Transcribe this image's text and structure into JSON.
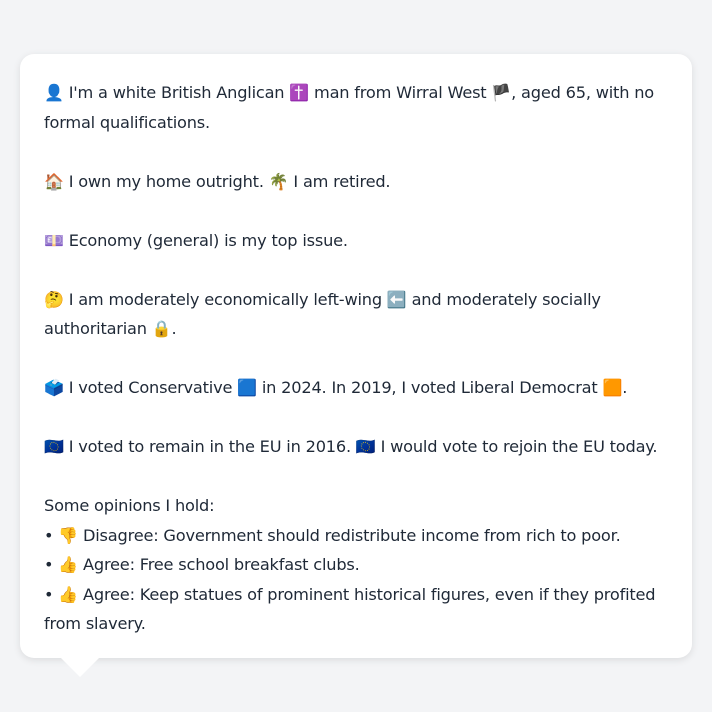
{
  "profile": {
    "identity": {
      "icon": "👤",
      "text": "I'm a white British Anglican",
      "religion_icon": "✝️",
      "text2": "man from Wirral West",
      "flag_icon": "🏴",
      "text3": ", aged 65, with no formal qualifications."
    },
    "home": {
      "icon": "🏠",
      "text": "I own my home outright.",
      "work_icon": "🌴",
      "text2": "I am retired."
    },
    "issue": {
      "icon": "💷",
      "text": "Economy (general) is my top issue."
    },
    "ideology": {
      "icon": "🤔",
      "text": "I am moderately economically left-wing",
      "econ_icon": "⬅️",
      "text2": "and moderately socially authoritarian",
      "social_icon": "🔒",
      "text3": "."
    },
    "vote": {
      "icon": "🗳️",
      "text": "I voted Conservative",
      "party_2024_icon": "🟦",
      "text2": "in 2024. In 2019, I voted Liberal Democrat",
      "party_2019_icon": "🟧",
      "text3": "."
    },
    "eu": {
      "icon": "🇪🇺",
      "text": "I voted to remain in the EU in 2016.",
      "icon2": "🇪🇺",
      "text2": "I would vote to rejoin the EU today."
    },
    "opinions_heading": "Some opinions I hold:",
    "opinions": [
      {
        "bullet": "•",
        "icon": "👎",
        "text": "Disagree: Government should redistribute income from rich to poor."
      },
      {
        "bullet": "•",
        "icon": "👍",
        "text": "Agree: Free school breakfast clubs."
      },
      {
        "bullet": "•",
        "icon": "👍",
        "text": "Agree: Keep statues of prominent historical figures, even if they profited from slavery."
      }
    ]
  }
}
